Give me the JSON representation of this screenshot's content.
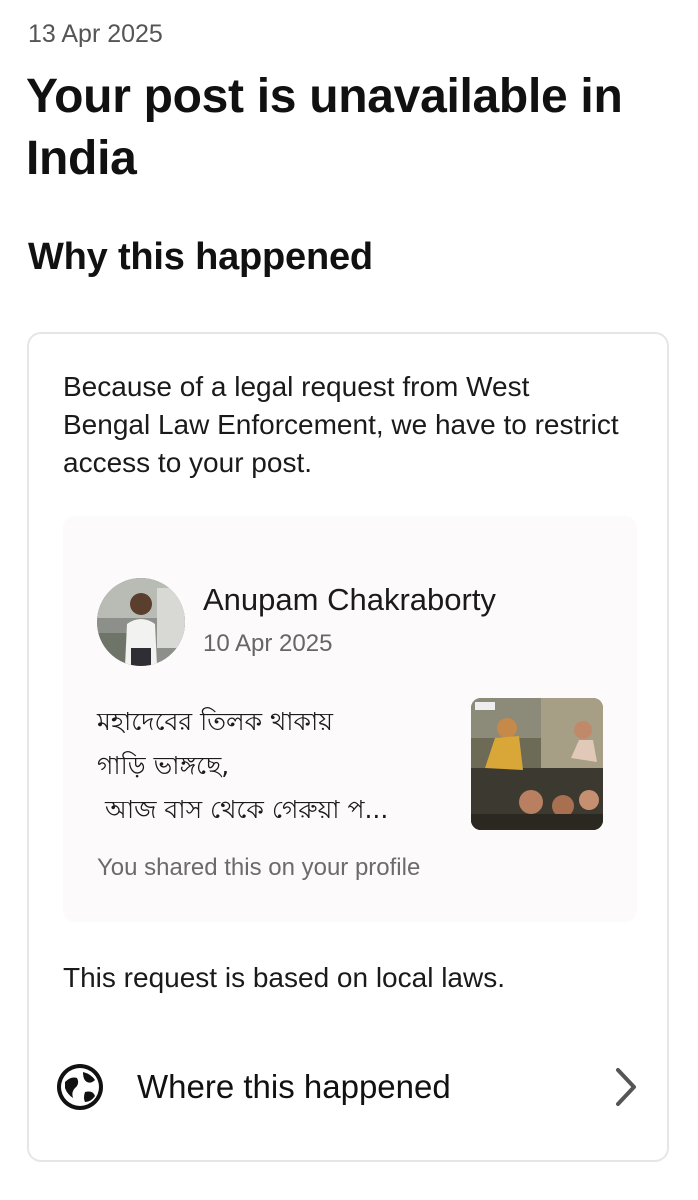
{
  "header": {
    "date": "13 Apr 2025",
    "title": "Your post is unavailable in India"
  },
  "reason_section": {
    "heading": "Why this happened",
    "explanation": "Because of a legal request from West Bengal Law Enforcement, we have to restrict access to your post.",
    "post": {
      "author_name": "Anupam Chakraborty",
      "date": "10 Apr 2025",
      "text_lines": [
        "মহাদেবের তিলক থাকায়",
        "গাড়ি ভাঙ্গছে,",
        " আজ বাস থেকে গেরুয়া প..."
      ],
      "shared_note": "You shared this on your profile",
      "avatar_icon": "profile-photo",
      "thumbnail_icon": "post-image"
    },
    "basis_note": "This request is based on local laws.",
    "where_link": {
      "label": "Where this happened",
      "icon": "globe-icon",
      "chevron": "chevron-right-icon"
    }
  }
}
